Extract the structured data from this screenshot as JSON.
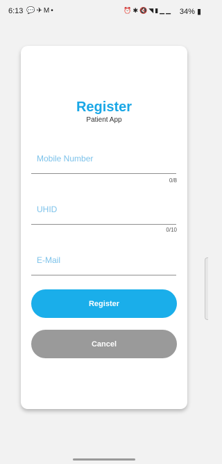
{
  "status_bar": {
    "time": "6:13",
    "left_icons": [
      "chat-bubble-icon",
      "messenger-icon",
      "gmail-icon",
      "dot-icon"
    ],
    "right_icons": [
      "alarm-icon",
      "bluetooth-icon",
      "mute-icon",
      "wifi-icon",
      "volte-icon",
      "signal-icon",
      "signal-icon-2"
    ],
    "battery": "34%"
  },
  "register_form": {
    "title": "Register",
    "subtitle": "Patient App",
    "fields": {
      "mobile": {
        "placeholder": "Mobile Number",
        "value": "",
        "counter": "0/8"
      },
      "uhid": {
        "placeholder": "UHID",
        "value": "",
        "counter": "0/10"
      },
      "email": {
        "placeholder": "E-Mail",
        "value": ""
      }
    },
    "buttons": {
      "register": "Register",
      "cancel": "Cancel"
    }
  },
  "colors": {
    "accent": "#1aa7e6",
    "button_register": "#1aaeea",
    "button_cancel": "#9a9a9a",
    "placeholder": "#7cc2ea",
    "background": "#f2f2f2"
  }
}
